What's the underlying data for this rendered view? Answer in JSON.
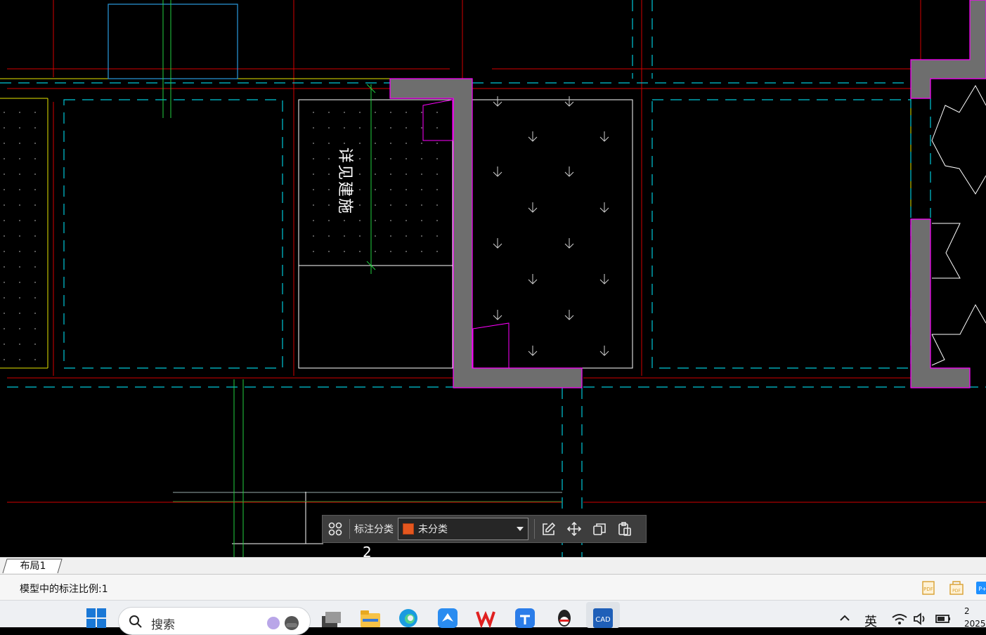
{
  "drawing": {
    "vertical_note": "详见建施"
  },
  "annotation_toolbar": {
    "category_label": "标注分类",
    "category_value": "未分类",
    "category_color": "#e4571f",
    "buttons": [
      "layout-icon",
      "edit-icon",
      "move-icon",
      "copy-icon",
      "paste-icon"
    ]
  },
  "layout_tabs": {
    "tabs": [
      {
        "label": "布局1"
      }
    ]
  },
  "status_bar": {
    "text": "模型中的标注比例:1",
    "icons": [
      "pdf-export-icon",
      "pdf-import-icon",
      "plugin-icon"
    ]
  },
  "taskbar": {
    "search_placeholder": "搜索",
    "apps": [
      "start-icon",
      "game-icon",
      "task-view-icon",
      "file-explorer-icon",
      "edge-icon",
      "bird-app-icon",
      "wps-icon",
      "cloud-app-icon",
      "qq-icon",
      "cad-icon"
    ],
    "tray_lang": "英",
    "tray_time": "2",
    "tray_date": "2025"
  },
  "colors": {
    "red_axis": "#d40000",
    "cyan_dash": "#00c8d8",
    "wall_fill": "#6e6e6e",
    "wall_edge": "#ff00ff",
    "yellow": "#e6e600",
    "green": "#22d040",
    "white": "#ffffff"
  }
}
